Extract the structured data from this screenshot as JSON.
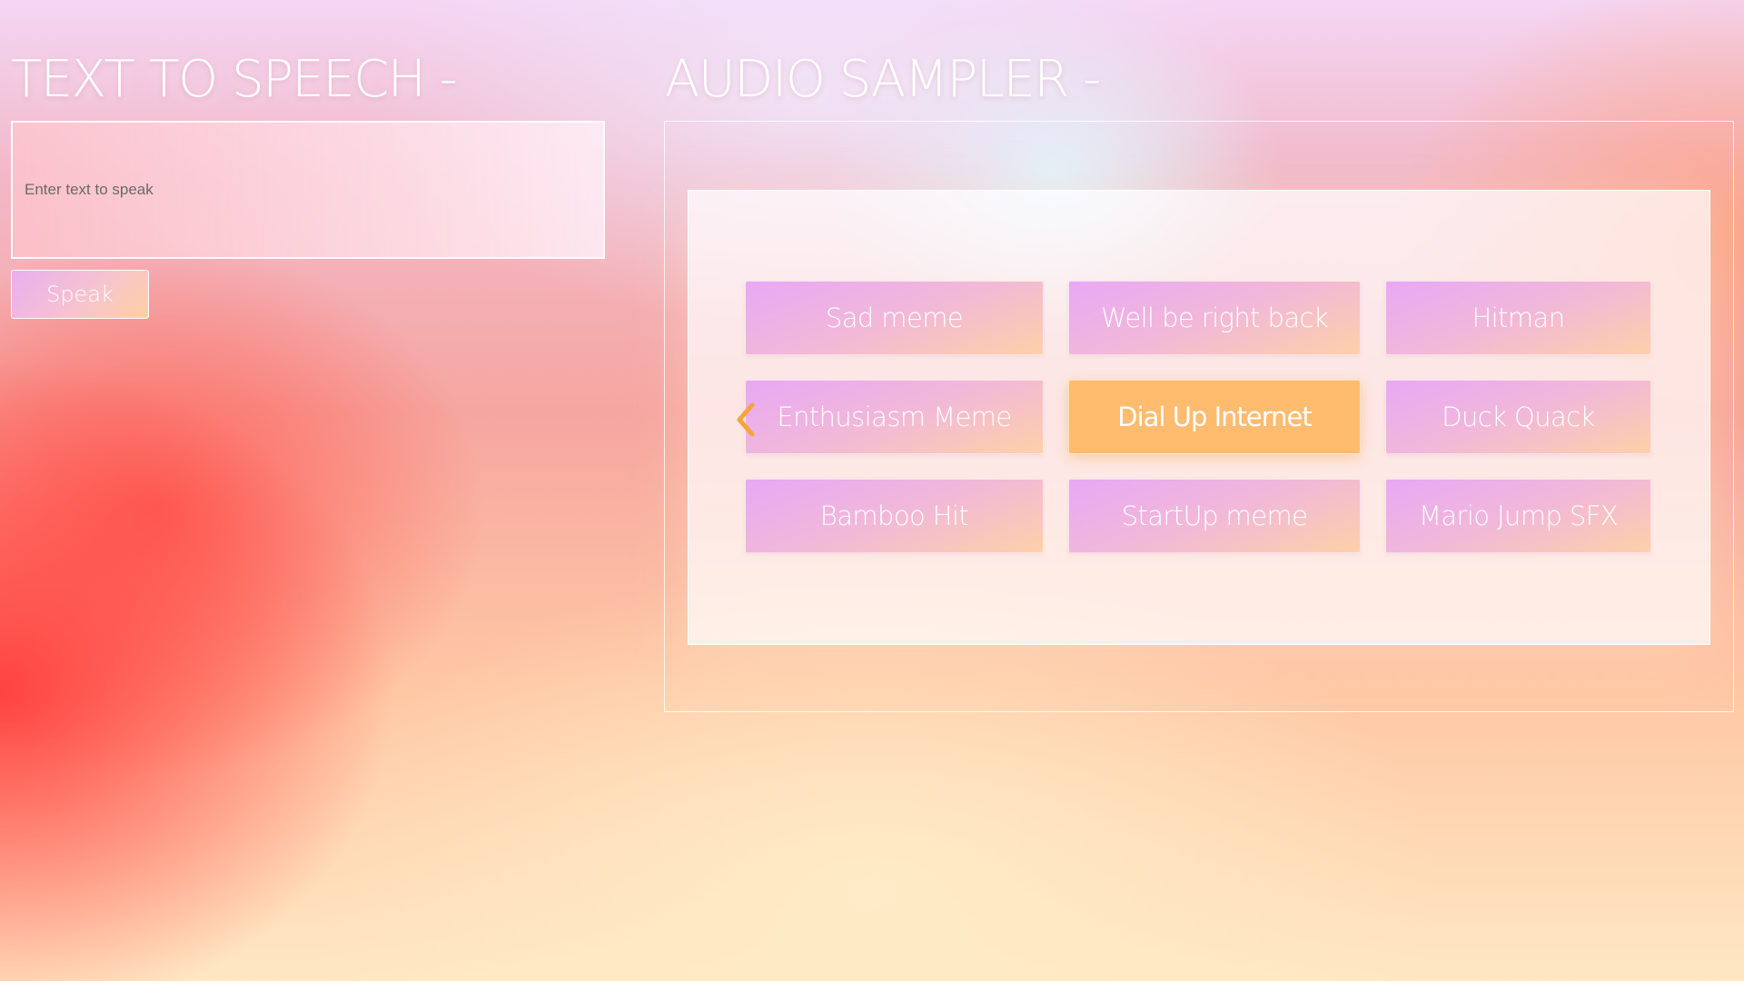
{
  "tts": {
    "title": "TEXT TO SPEECH -",
    "input_placeholder": "Enter text to speak",
    "input_value": "",
    "speak_label": "Speak"
  },
  "sampler": {
    "title": "AUDIO SAMPLER -",
    "buttons": [
      {
        "label": "Sad meme",
        "active": false
      },
      {
        "label": "Well be right back",
        "active": false
      },
      {
        "label": "Hitman",
        "active": false
      },
      {
        "label": "Enthusiasm Meme",
        "active": false
      },
      {
        "label": "Dial Up Internet",
        "active": true
      },
      {
        "label": "Duck Quack",
        "active": false
      },
      {
        "label": "Bamboo Hit",
        "active": false
      },
      {
        "label": "StartUp meme",
        "active": false
      },
      {
        "label": "Mario Jump SFX",
        "active": false
      }
    ]
  },
  "icons": {
    "chevron": "chevron-left-icon"
  },
  "colors": {
    "active_button": "#ffbb6e",
    "text": "#ffffff",
    "chevron": "#f5a43e"
  }
}
